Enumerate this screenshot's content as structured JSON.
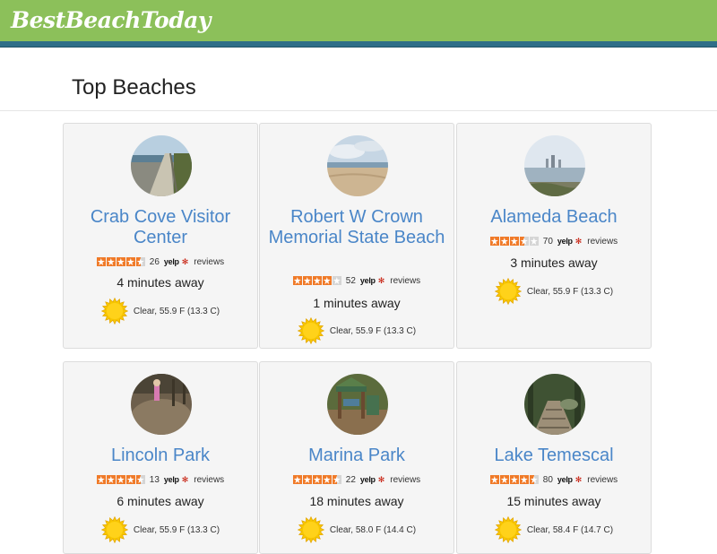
{
  "nav": {
    "brand": "BestBeachToday"
  },
  "page": {
    "title": "Top Beaches"
  },
  "reviews_label": "reviews",
  "yelp_label": "yelp",
  "beaches": [
    {
      "name": "Crab Cove Visitor Center",
      "rating": 4.5,
      "review_count": "26",
      "away": "4 minutes away",
      "weather": "Clear, 55.9 F (13.3 C)",
      "image": "pier-boardwalk"
    },
    {
      "name": "Robert W Crown Memorial State Beach",
      "rating": 4,
      "review_count": "52",
      "away": "1 minutes away",
      "weather": "Clear, 55.9 F (13.3 C)",
      "image": "sandy-beach"
    },
    {
      "name": "Alameda Beach",
      "rating": 3.5,
      "review_count": "70",
      "away": "3 minutes away",
      "weather": "Clear, 55.9 F (13.3 C)",
      "image": "bay-skyline"
    },
    {
      "name": "Lincoln Park",
      "rating": 4.5,
      "review_count": "13",
      "away": "6 minutes away",
      "weather": "Clear, 55.9 F (13.3 C)",
      "image": "park-playground"
    },
    {
      "name": "Marina Park",
      "rating": 4.5,
      "review_count": "22",
      "away": "18 minutes away",
      "weather": "Clear, 58.0 F (14.4 C)",
      "image": "play-structure"
    },
    {
      "name": "Lake Temescal",
      "rating": 4.5,
      "review_count": "80",
      "away": "15 minutes away",
      "weather": "Clear, 58.4 F (14.7 C)",
      "image": "wooded-trail"
    }
  ],
  "colors": {
    "navbar": "#8cc05a",
    "stripe": "#2f6e88",
    "title_link": "#4a86c8",
    "star_on": "#f07a28",
    "sun": "#f7c600"
  },
  "icons": {
    "weather": "sun-icon",
    "rating": "star-icon"
  }
}
